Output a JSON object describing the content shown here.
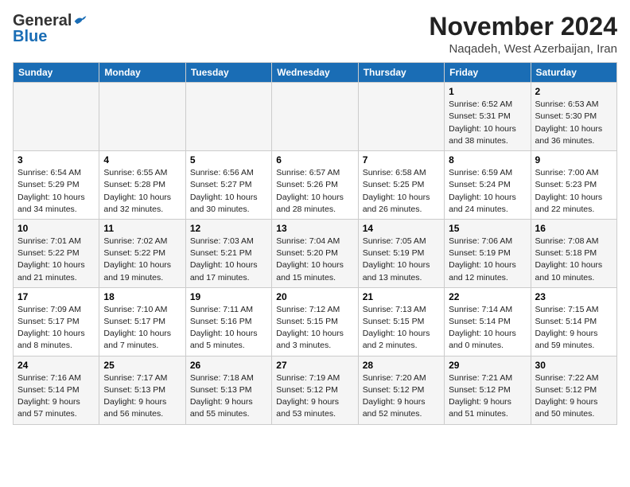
{
  "logo": {
    "general": "General",
    "blue": "Blue"
  },
  "title": "November 2024",
  "subtitle": "Naqadeh, West Azerbaijan, Iran",
  "days_of_week": [
    "Sunday",
    "Monday",
    "Tuesday",
    "Wednesday",
    "Thursday",
    "Friday",
    "Saturday"
  ],
  "weeks": [
    [
      {
        "day": "",
        "info": ""
      },
      {
        "day": "",
        "info": ""
      },
      {
        "day": "",
        "info": ""
      },
      {
        "day": "",
        "info": ""
      },
      {
        "day": "",
        "info": ""
      },
      {
        "day": "1",
        "info": "Sunrise: 6:52 AM\nSunset: 5:31 PM\nDaylight: 10 hours\nand 38 minutes."
      },
      {
        "day": "2",
        "info": "Sunrise: 6:53 AM\nSunset: 5:30 PM\nDaylight: 10 hours\nand 36 minutes."
      }
    ],
    [
      {
        "day": "3",
        "info": "Sunrise: 6:54 AM\nSunset: 5:29 PM\nDaylight: 10 hours\nand 34 minutes."
      },
      {
        "day": "4",
        "info": "Sunrise: 6:55 AM\nSunset: 5:28 PM\nDaylight: 10 hours\nand 32 minutes."
      },
      {
        "day": "5",
        "info": "Sunrise: 6:56 AM\nSunset: 5:27 PM\nDaylight: 10 hours\nand 30 minutes."
      },
      {
        "day": "6",
        "info": "Sunrise: 6:57 AM\nSunset: 5:26 PM\nDaylight: 10 hours\nand 28 minutes."
      },
      {
        "day": "7",
        "info": "Sunrise: 6:58 AM\nSunset: 5:25 PM\nDaylight: 10 hours\nand 26 minutes."
      },
      {
        "day": "8",
        "info": "Sunrise: 6:59 AM\nSunset: 5:24 PM\nDaylight: 10 hours\nand 24 minutes."
      },
      {
        "day": "9",
        "info": "Sunrise: 7:00 AM\nSunset: 5:23 PM\nDaylight: 10 hours\nand 22 minutes."
      }
    ],
    [
      {
        "day": "10",
        "info": "Sunrise: 7:01 AM\nSunset: 5:22 PM\nDaylight: 10 hours\nand 21 minutes."
      },
      {
        "day": "11",
        "info": "Sunrise: 7:02 AM\nSunset: 5:22 PM\nDaylight: 10 hours\nand 19 minutes."
      },
      {
        "day": "12",
        "info": "Sunrise: 7:03 AM\nSunset: 5:21 PM\nDaylight: 10 hours\nand 17 minutes."
      },
      {
        "day": "13",
        "info": "Sunrise: 7:04 AM\nSunset: 5:20 PM\nDaylight: 10 hours\nand 15 minutes."
      },
      {
        "day": "14",
        "info": "Sunrise: 7:05 AM\nSunset: 5:19 PM\nDaylight: 10 hours\nand 13 minutes."
      },
      {
        "day": "15",
        "info": "Sunrise: 7:06 AM\nSunset: 5:19 PM\nDaylight: 10 hours\nand 12 minutes."
      },
      {
        "day": "16",
        "info": "Sunrise: 7:08 AM\nSunset: 5:18 PM\nDaylight: 10 hours\nand 10 minutes."
      }
    ],
    [
      {
        "day": "17",
        "info": "Sunrise: 7:09 AM\nSunset: 5:17 PM\nDaylight: 10 hours\nand 8 minutes."
      },
      {
        "day": "18",
        "info": "Sunrise: 7:10 AM\nSunset: 5:17 PM\nDaylight: 10 hours\nand 7 minutes."
      },
      {
        "day": "19",
        "info": "Sunrise: 7:11 AM\nSunset: 5:16 PM\nDaylight: 10 hours\nand 5 minutes."
      },
      {
        "day": "20",
        "info": "Sunrise: 7:12 AM\nSunset: 5:15 PM\nDaylight: 10 hours\nand 3 minutes."
      },
      {
        "day": "21",
        "info": "Sunrise: 7:13 AM\nSunset: 5:15 PM\nDaylight: 10 hours\nand 2 minutes."
      },
      {
        "day": "22",
        "info": "Sunrise: 7:14 AM\nSunset: 5:14 PM\nDaylight: 10 hours\nand 0 minutes."
      },
      {
        "day": "23",
        "info": "Sunrise: 7:15 AM\nSunset: 5:14 PM\nDaylight: 9 hours\nand 59 minutes."
      }
    ],
    [
      {
        "day": "24",
        "info": "Sunrise: 7:16 AM\nSunset: 5:14 PM\nDaylight: 9 hours\nand 57 minutes."
      },
      {
        "day": "25",
        "info": "Sunrise: 7:17 AM\nSunset: 5:13 PM\nDaylight: 9 hours\nand 56 minutes."
      },
      {
        "day": "26",
        "info": "Sunrise: 7:18 AM\nSunset: 5:13 PM\nDaylight: 9 hours\nand 55 minutes."
      },
      {
        "day": "27",
        "info": "Sunrise: 7:19 AM\nSunset: 5:12 PM\nDaylight: 9 hours\nand 53 minutes."
      },
      {
        "day": "28",
        "info": "Sunrise: 7:20 AM\nSunset: 5:12 PM\nDaylight: 9 hours\nand 52 minutes."
      },
      {
        "day": "29",
        "info": "Sunrise: 7:21 AM\nSunset: 5:12 PM\nDaylight: 9 hours\nand 51 minutes."
      },
      {
        "day": "30",
        "info": "Sunrise: 7:22 AM\nSunset: 5:12 PM\nDaylight: 9 hours\nand 50 minutes."
      }
    ]
  ]
}
